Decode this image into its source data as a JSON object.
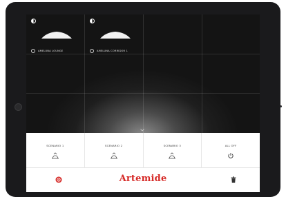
{
  "tiles": [
    {
      "label": "AMELUNA LOUNGE"
    },
    {
      "label": "AMELUNA CORRIDOR 1"
    }
  ],
  "scenarios": [
    {
      "label": "SCENARIO 1",
      "icon": "scenario-icon"
    },
    {
      "label": "SCENARIO 2",
      "icon": "scenario-icon"
    },
    {
      "label": "SCENARIO 3",
      "icon": "scenario-icon"
    },
    {
      "label": "ALL OFF",
      "icon": "power-icon"
    }
  ],
  "footer": {
    "brand": "Artemide",
    "settings_icon": "settings-icon",
    "trash_icon": "trash-icon"
  },
  "colors": {
    "brand_red": "#d62b28",
    "screen_dark": "#141414",
    "panel_bg": "#ffffff"
  }
}
